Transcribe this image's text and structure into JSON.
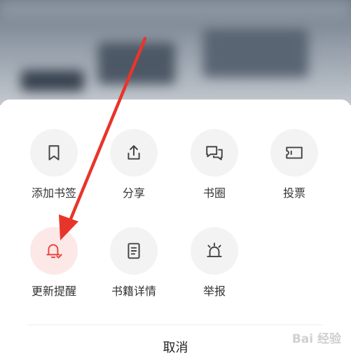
{
  "actions": [
    {
      "id": "bookmark",
      "label": "添加书签",
      "icon": "bookmark-icon"
    },
    {
      "id": "share",
      "label": "分享",
      "icon": "share-icon"
    },
    {
      "id": "circle",
      "label": "书圈",
      "icon": "chat-bubbles-icon"
    },
    {
      "id": "vote",
      "label": "投票",
      "icon": "ticket-icon"
    },
    {
      "id": "update-reminder",
      "label": "更新提醒",
      "icon": "bell-check-icon",
      "active": true
    },
    {
      "id": "book-details",
      "label": "书籍详情",
      "icon": "document-icon"
    },
    {
      "id": "report",
      "label": "举报",
      "icon": "alarm-light-icon"
    }
  ],
  "cancel_label": "取消",
  "watermark_text": "Bai 经验",
  "colors": {
    "accent": "#e8453c",
    "icon": "#444444",
    "circle_bg": "#f3f3f3",
    "active_circle_bg": "#fde8e8"
  }
}
